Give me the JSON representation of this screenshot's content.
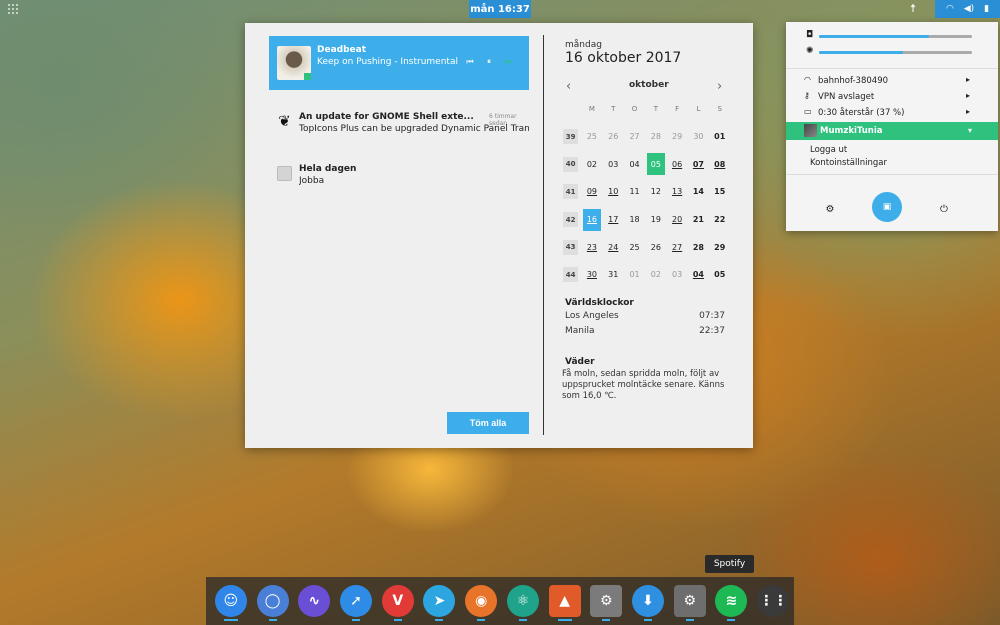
{
  "topbar": {
    "clock": "mån 16:37",
    "status_icons": [
      "wifi-icon",
      "volume-icon",
      "power-icon"
    ]
  },
  "media": {
    "artist": "Deadbeat",
    "track": "Keep on Pushing - Instrumental",
    "controls": [
      "⏮",
      "⏸",
      "⏭"
    ]
  },
  "notifications": [
    {
      "title": "An update for GNOME Shell exte...",
      "time": "6 timmar sedan",
      "body": "TopIcons Plus can be upgraded Dynamic Panel Tran..."
    },
    {
      "title": "Hela dagen",
      "body": "Jobba"
    }
  ],
  "clear_all": "Töm alla",
  "calendar": {
    "weekday": "måndag",
    "date": "16 oktober 2017",
    "month": "oktober",
    "day_headers": [
      "M",
      "T",
      "O",
      "T",
      "F",
      "L",
      "S"
    ],
    "weeks": [
      {
        "wk": "39",
        "days": [
          "25",
          "26",
          "27",
          "28",
          "29",
          "30",
          "01"
        ]
      },
      {
        "wk": "40",
        "days": [
          "02",
          "03",
          "04",
          "05",
          "06",
          "07",
          "08"
        ]
      },
      {
        "wk": "41",
        "days": [
          "09",
          "10",
          "11",
          "12",
          "13",
          "14",
          "15"
        ]
      },
      {
        "wk": "42",
        "days": [
          "16",
          "17",
          "18",
          "19",
          "20",
          "21",
          "22"
        ]
      },
      {
        "wk": "43",
        "days": [
          "23",
          "24",
          "25",
          "26",
          "27",
          "28",
          "29"
        ]
      },
      {
        "wk": "44",
        "days": [
          "30",
          "31",
          "01",
          "02",
          "03",
          "04",
          "05"
        ]
      }
    ]
  },
  "world_clocks": {
    "title": "Världsklockor",
    "rows": [
      {
        "city": "Los Angeles",
        "time": "07:37"
      },
      {
        "city": "Manila",
        "time": "22:37"
      }
    ]
  },
  "weather": {
    "title": "Väder",
    "text": "Få moln, sedan spridda moln, följt av uppsprucket molntäcke senare. Känns som 16,0 ℃."
  },
  "system_menu": {
    "volume_level": 0.72,
    "brightness_level": 0.55,
    "wifi": "bahnhof-380490",
    "vpn": "VPN avslaget",
    "battery": "0:30 återstår (37 %)",
    "user": "MumzkiTunia",
    "logout": "Logga ut",
    "account_settings": "Kontoinställningar"
  },
  "tooltip": "Spotify",
  "dock": [
    {
      "icon": "finder-icon",
      "color": "#2f86e8",
      "glyph": "☺"
    },
    {
      "icon": "chromium-icon",
      "color": "#4a7fd8",
      "glyph": "◯"
    },
    {
      "icon": "audio-wave-icon",
      "color": "#6a4fd6",
      "glyph": "∿"
    },
    {
      "icon": "safari-compass-icon",
      "color": "#2e8be6",
      "glyph": "➚"
    },
    {
      "icon": "vivaldi-icon",
      "color": "#e23a36",
      "glyph": "V"
    },
    {
      "icon": "telegram-icon",
      "color": "#2ca5e0",
      "glyph": "➤"
    },
    {
      "icon": "firefox-icon",
      "color": "#e8742a",
      "glyph": "◉"
    },
    {
      "icon": "atom-icon",
      "color": "#1fa38a",
      "glyph": "⚛"
    },
    {
      "icon": "gimp-icon",
      "color": "#e05a2a",
      "glyph": "▲"
    },
    {
      "icon": "system-settings-icon",
      "color": "#7b7b7b",
      "glyph": "⚙"
    },
    {
      "icon": "download-icon",
      "color": "#2f8fe0",
      "glyph": "⬇"
    },
    {
      "icon": "gear-settings-icon",
      "color": "#6e6e6e",
      "glyph": "⚙"
    },
    {
      "icon": "spotify-icon",
      "color": "#1db954",
      "glyph": "≋"
    },
    {
      "icon": "app-grid-icon",
      "color": "#3a3a3a",
      "glyph": "⋮⋮"
    }
  ]
}
